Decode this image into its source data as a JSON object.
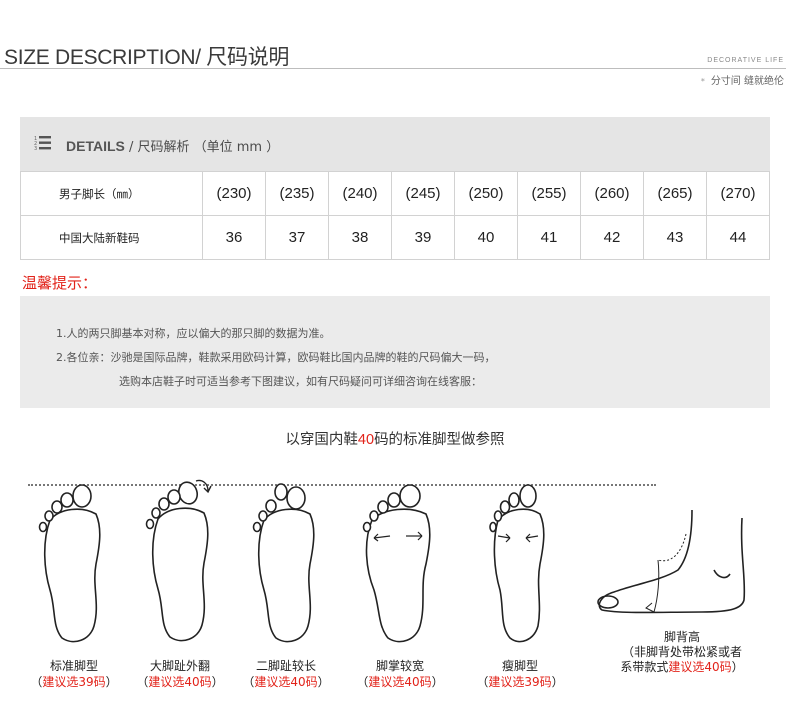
{
  "header": {
    "title": "SIZE DESCRIPTION/ 尺码说明",
    "decor_label": "DECORATIVE LIFE",
    "decor_slogan": "分寸间 缝就绝伦"
  },
  "details": {
    "title_en": "DETAILS",
    "title_zh": " / 尺码解析 （单位 mm ）"
  },
  "size_table": {
    "rows": [
      {
        "label": "男子脚长（㎜）",
        "cells": [
          "(230)",
          "(235)",
          "(240)",
          "(245)",
          "(250)",
          "(255)",
          "(260)",
          "(265)",
          "(270)"
        ]
      },
      {
        "label": "中国大陆新鞋码",
        "cells": [
          "36",
          "37",
          "38",
          "39",
          "40",
          "41",
          "42",
          "43",
          "44"
        ]
      }
    ]
  },
  "tips": {
    "title": "温馨提示：",
    "line1": "1.人的两只脚基本对称，应以偏大的那只脚的数据为准。",
    "line2": "2.各位亲：沙驰是国际品牌，鞋款采用欧码计算，欧码鞋比国内品牌的鞋的尺码偏大一码，",
    "line3": "选购本店鞋子时可适当参考下图建议，如有尺码疑问可详细咨询在线客服："
  },
  "reference": {
    "title_pre": "以穿国内鞋",
    "title_size": "40",
    "title_post": "码的标准脚型做参照"
  },
  "feet": [
    {
      "name": "标准脚型",
      "advice": "建议选39码"
    },
    {
      "name": "大脚趾外翻",
      "advice": "建议选40码"
    },
    {
      "name": "二脚趾较长",
      "advice": "建议选40码"
    },
    {
      "name": "脚掌较宽",
      "advice": "建议选40码"
    },
    {
      "name": "瘦脚型",
      "advice": "建议选39码"
    },
    {
      "name": "脚背高",
      "note_pre": "非脚背处带松紧或者",
      "note_post": "系带款式",
      "advice": "建议选40码"
    }
  ],
  "colors": {
    "accent_red": "#e2231a",
    "panel_gray": "#e5e5e5"
  }
}
